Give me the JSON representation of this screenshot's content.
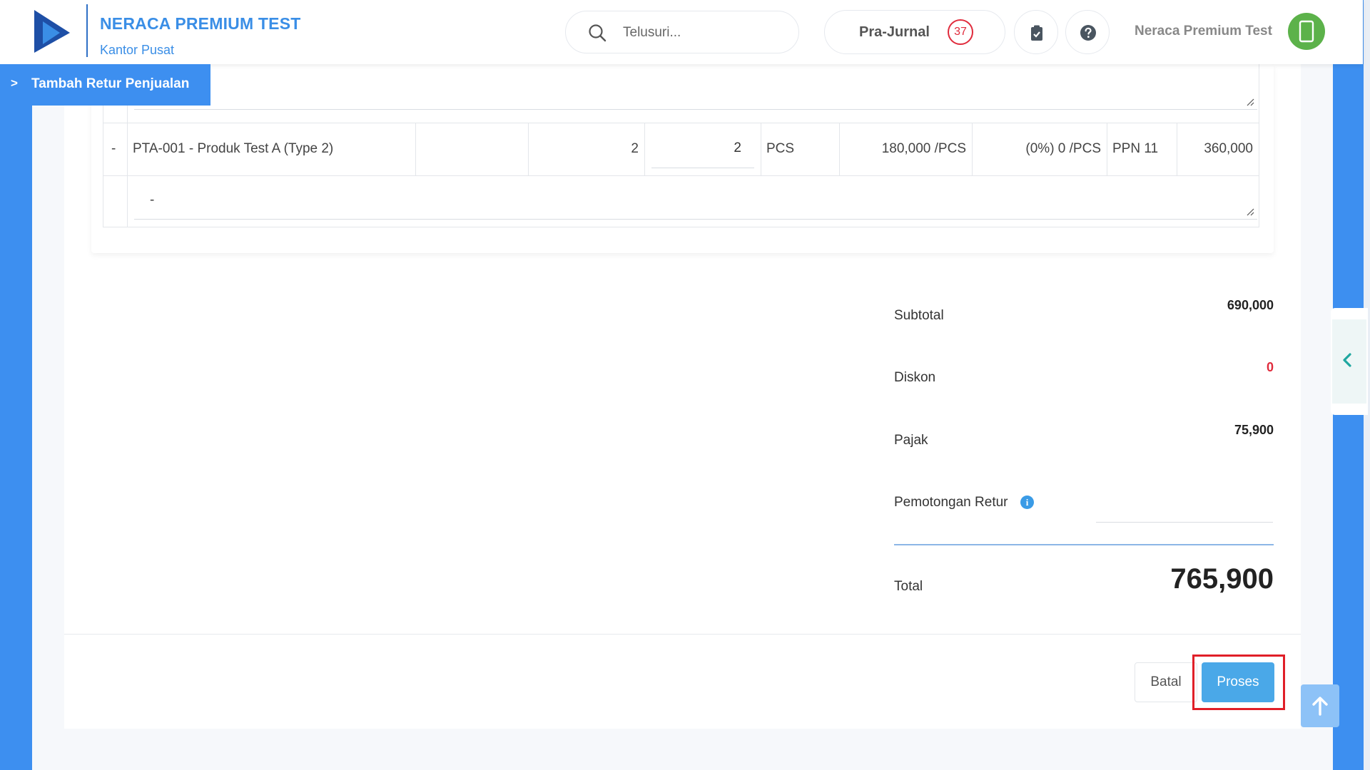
{
  "header": {
    "brand_title": "NERACA PREMIUM TEST",
    "brand_subtitle": "Kantor Pusat",
    "search_placeholder": "Telusuri...",
    "prajurnal_label": "Pra-Jurnal",
    "prajurnal_count": "37",
    "user_name": "Neraca Premium Test"
  },
  "page_tab": {
    "chevron": ">",
    "label": "Tambah Retur Penjualan"
  },
  "table": {
    "rows": [
      {
        "bullet": "-",
        "product": "PTA-001 - Produk Test A (Type 2)",
        "qty": "2",
        "qty_return": "2",
        "unit": "PCS",
        "price": "180,000 /PCS",
        "discount": "(0%) 0 /PCS",
        "tax": "PPN 11",
        "amount": "360,000",
        "note": "-"
      }
    ]
  },
  "summary": {
    "subtotal_label": "Subtotal",
    "subtotal_value": "690,000",
    "diskon_label": "Diskon",
    "diskon_value": "0",
    "pajak_label": "Pajak",
    "pajak_value": "75,900",
    "potongan_label": "Pemotongan Retur",
    "total_label": "Total",
    "total_value": "765,900"
  },
  "actions": {
    "batal_label": "Batal",
    "proses_label": "Proses"
  },
  "colors": {
    "primary": "#3d8ff0",
    "brand_text": "#3a8ee6",
    "danger": "#e02b3c",
    "proses_button": "#4aa8e8",
    "avatar": "#5cb24a"
  }
}
